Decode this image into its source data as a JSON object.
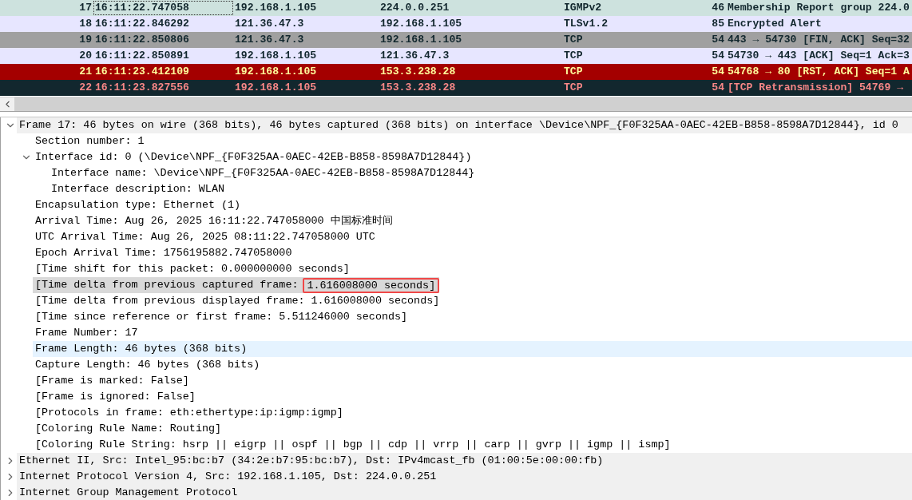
{
  "packet_list": {
    "rows": [
      {
        "no": "17",
        "time": "16:11:22.747058",
        "source": "192.168.1.105",
        "destination": "224.0.0.251",
        "protocol": "IGMPv2",
        "length": "46",
        "info": "Membership Report group 224.0",
        "color": "#cde2de",
        "selected": true
      },
      {
        "no": "18",
        "time": "16:11:22.846292",
        "source": "121.36.47.3",
        "destination": "192.168.1.105",
        "protocol": "TLSv1.2",
        "length": "85",
        "info": "Encrypted Alert",
        "color": "#e7e6ff",
        "selected": false
      },
      {
        "no": "19",
        "time": "16:11:22.850806",
        "source": "121.36.47.3",
        "destination": "192.168.1.105",
        "protocol": "TCP",
        "length": "54",
        "info": "443 → 54730 [FIN, ACK] Seq=32",
        "color": "#a0a0a0",
        "selected": false
      },
      {
        "no": "20",
        "time": "16:11:22.850891",
        "source": "192.168.1.105",
        "destination": "121.36.47.3",
        "protocol": "TCP",
        "length": "54",
        "info": "54730 → 443 [ACK] Seq=1 Ack=3",
        "color": "#e7e6ff",
        "selected": false
      },
      {
        "no": "21",
        "time": "16:11:23.412109",
        "source": "192.168.1.105",
        "destination": "153.3.238.28",
        "protocol": "TCP",
        "length": "54",
        "info": "54768 → 80 [RST, ACK] Seq=1 A",
        "color": "#a40000",
        "selected": false
      },
      {
        "no": "22",
        "time": "16:11:23.827556",
        "source": "192.168.1.105",
        "destination": "153.3.238.28",
        "protocol": "TCP",
        "length": "54",
        "info": "[TCP Retransmission] 54769 →",
        "color": "#12272e",
        "selected": false
      }
    ]
  },
  "details": {
    "items": [
      {
        "label": "Frame 17: 46 bytes on wire (368 bits), 46 bytes captured (368 bits) on interface \\Device\\NPF_{F0F325AA-0AEC-42EB-B858-8598A7D12844}, id 0",
        "expanded": true,
        "selected": false,
        "hovered": false,
        "children": [
          {
            "label": "Section number: 1",
            "selected": false,
            "hovered": false
          },
          {
            "label": "Interface id: 0 (\\Device\\NPF_{F0F325AA-0AEC-42EB-B858-8598A7D12844})",
            "expanded": true,
            "selected": false,
            "hovered": false,
            "children": [
              {
                "label": "Interface name: \\Device\\NPF_{F0F325AA-0AEC-42EB-B858-8598A7D12844}",
                "selected": false,
                "hovered": false
              },
              {
                "label": "Interface description: WLAN",
                "selected": false,
                "hovered": false
              }
            ]
          },
          {
            "label": "Encapsulation type: Ethernet (1)",
            "selected": false,
            "hovered": false
          },
          {
            "label": "Arrival Time: Aug 26, 2025 16:11:22.747058000 中国标准时间",
            "selected": false,
            "hovered": false
          },
          {
            "label": "UTC Arrival Time: Aug 26, 2025 08:11:22.747058000 UTC",
            "selected": false,
            "hovered": false
          },
          {
            "label": "Epoch Arrival Time: 1756195882.747058000",
            "selected": false,
            "hovered": false
          },
          {
            "label": "[Time shift for this packet: 0.000000000 seconds]",
            "selected": false,
            "hovered": false
          },
          {
            "label": "[Time delta from previous captured frame:",
            "annotated": "1.616008000 seconds",
            "suffix": "]",
            "selected": true,
            "hovered": false
          },
          {
            "label": "[Time delta from previous displayed frame: 1.616008000 seconds]",
            "selected": false,
            "hovered": false
          },
          {
            "label": "[Time since reference or first frame: 5.511246000 seconds]",
            "selected": false,
            "hovered": false
          },
          {
            "label": "Frame Number: 17",
            "selected": false,
            "hovered": false
          },
          {
            "label": "Frame Length: 46 bytes (368 bits)",
            "selected": false,
            "hovered": true
          },
          {
            "label": "Capture Length: 46 bytes (368 bits)",
            "selected": false,
            "hovered": false
          },
          {
            "label": "[Frame is marked: False]",
            "selected": false,
            "hovered": false
          },
          {
            "label": "[Frame is ignored: False]",
            "selected": false,
            "hovered": false
          },
          {
            "label": "[Protocols in frame: eth:ethertype:ip:igmp:igmp]",
            "selected": false,
            "hovered": false
          },
          {
            "label": "[Coloring Rule Name: Routing]",
            "selected": false,
            "hovered": false
          },
          {
            "label": "[Coloring Rule String: hsrp || eigrp || ospf || bgp || cdp || vrrp || carp || gvrp || igmp || ismp]",
            "selected": false,
            "hovered": false
          }
        ]
      },
      {
        "label": "Ethernet II, Src: Intel_95:bc:b7 (34:2e:b7:95:bc:b7), Dst: IPv4mcast_fb (01:00:5e:00:00:fb)",
        "expanded": false,
        "selected": false,
        "hovered": false
      },
      {
        "label": "Internet Protocol Version 4, Src: 192.168.1.105, Dst: 224.0.0.251",
        "expanded": false,
        "selected": false,
        "hovered": false
      },
      {
        "label": "Internet Group Management Protocol",
        "expanded": false,
        "selected": false,
        "hovered": false
      }
    ]
  }
}
